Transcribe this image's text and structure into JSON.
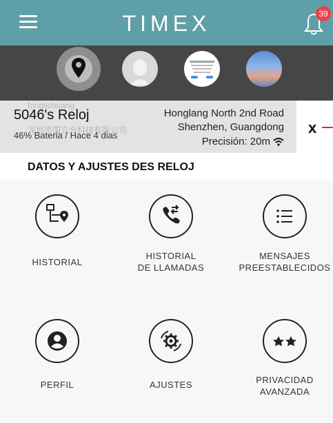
{
  "header": {
    "logo": "TIMEX",
    "notification_count": "39"
  },
  "device": {
    "name": "5046's Reloj",
    "status": "46% Bateria / Hace 4 dias",
    "address_line1": "Honglang North 2nd Road",
    "address_line2": "Shenzhen, Guangdong",
    "precision": "Precisión: 20m",
    "close_label": "x",
    "watermark_1": "fonglichuang",
    "watermark_2": "深圳市国立合科技有限公司"
  },
  "section": {
    "title": "DATOS Y AJUSTES DES RELOJ"
  },
  "tiles": [
    {
      "label_1": "HISTORIAL",
      "label_2": "",
      "icon": "history-route-icon"
    },
    {
      "label_1": "HISTORIAL",
      "label_2": "DE LLAMADAS",
      "icon": "call-history-icon"
    },
    {
      "label_1": "MENSAJES",
      "label_2": "PREESTABLECIDOS",
      "icon": "list-icon"
    },
    {
      "label_1": "PERFIL",
      "label_2": "",
      "icon": "profile-icon"
    },
    {
      "label_1": "AJUSTES",
      "label_2": "",
      "icon": "settings-gear-icon"
    },
    {
      "label_1": "PRIVACIDAD",
      "label_2": "AVANZADA",
      "icon": "stars-icon"
    }
  ],
  "colors": {
    "header": "#5f9fa8",
    "avatar_bar": "#464646",
    "badge": "#e8404a",
    "accent_line": "#e0284a"
  }
}
